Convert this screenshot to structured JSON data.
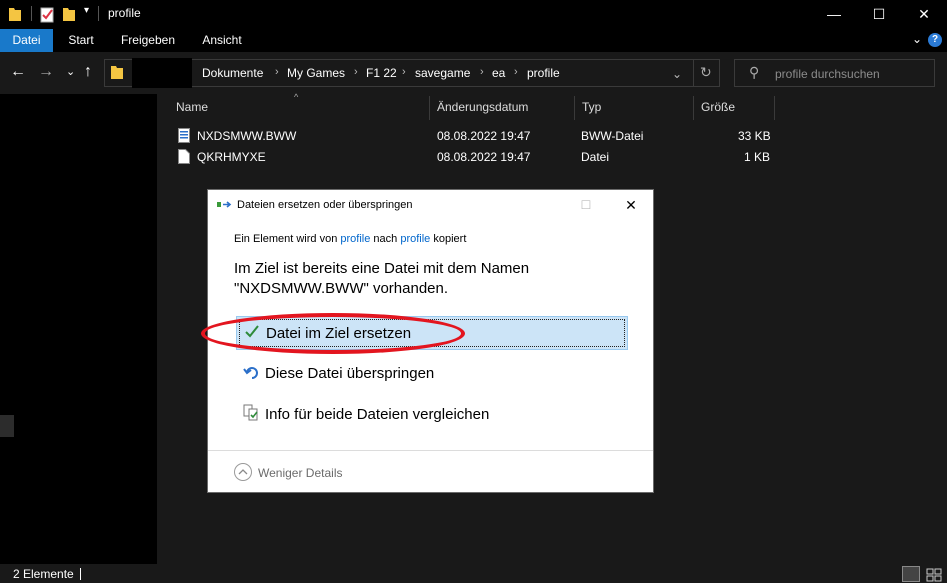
{
  "window": {
    "title": "profile",
    "controls": {
      "minimize": "—",
      "maximize": "☐",
      "close": "✕"
    }
  },
  "ribbon": {
    "tabs": [
      {
        "label": "Datei",
        "active": true
      },
      {
        "label": "Start"
      },
      {
        "label": "Freigeben"
      },
      {
        "label": "Ansicht"
      }
    ],
    "help": "?"
  },
  "address": {
    "crumbs": [
      "Dokumente",
      "My Games",
      "F1 22",
      "savegame",
      "ea",
      "profile"
    ]
  },
  "search": {
    "placeholder": "profile durchsuchen"
  },
  "columns": [
    "Name",
    "Änderungsdatum",
    "Typ",
    "Größe"
  ],
  "files": [
    {
      "name": "NXDSMWW.BWW",
      "date": "08.08.2022 19:47",
      "type": "BWW-Datei",
      "size": "33 KB"
    },
    {
      "name": "QKRHMYXE",
      "date": "08.08.2022 19:47",
      "type": "Datei",
      "size": "1 KB"
    }
  ],
  "status": {
    "count": "2 Elemente"
  },
  "dialog": {
    "title": "Dateien ersetzen oder überspringen",
    "info": {
      "prefix": "Ein Element wird von",
      "source": "profile",
      "middle": "nach",
      "target": "profile",
      "suffix": "kopiert"
    },
    "message_line1": "Im Ziel ist bereits eine Datei mit dem Namen",
    "message_line2": "\"NXDSMWW.BWW\" vorhanden.",
    "options": [
      {
        "label": "Datei im Ziel ersetzen",
        "icon": "checkmark-icon",
        "selected": true
      },
      {
        "label": "Diese Datei überspringen",
        "icon": "skip-arrow-icon"
      },
      {
        "label": "Info für beide Dateien vergleichen",
        "icon": "compare-files-icon"
      }
    ],
    "footer": "Weniger Details"
  },
  "colors": {
    "accent": "#1979ca",
    "selection": "#cce4f7",
    "annotation": "#e3151f",
    "link": "#0066cc"
  }
}
